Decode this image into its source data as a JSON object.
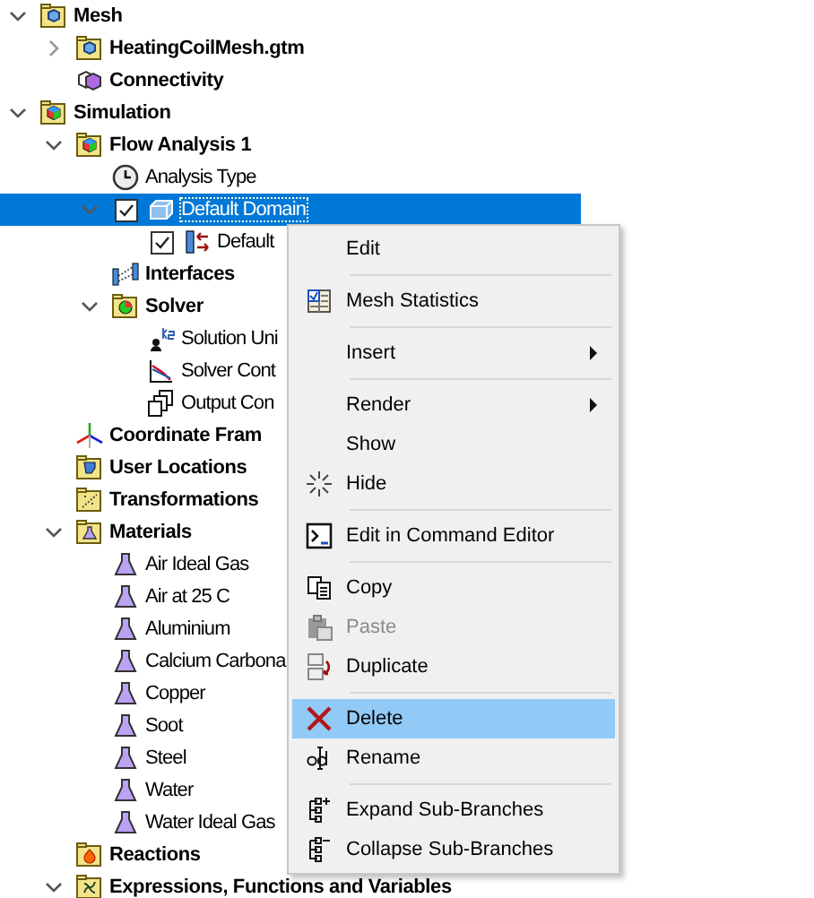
{
  "tree": [
    {
      "label": "Mesh",
      "kind": "folder-mesh",
      "bold": true,
      "expanded": true,
      "selected": false,
      "children": [
        {
          "label": "HeatingCoilMesh.gtm",
          "kind": "folder-mesh",
          "bold": true,
          "expanded": false,
          "selected": false
        },
        {
          "label": "Connectivity",
          "kind": "connectivity",
          "bold": true,
          "selected": false
        }
      ]
    },
    {
      "label": "Simulation",
      "kind": "folder-sim",
      "bold": true,
      "expanded": true,
      "selected": false,
      "children": [
        {
          "label": "Flow Analysis 1",
          "kind": "folder-sim",
          "bold": true,
          "expanded": true,
          "selected": false,
          "children": [
            {
              "label": "Analysis Type",
              "kind": "clock",
              "bold": false,
              "selected": false
            },
            {
              "label": "Default Domain",
              "kind": "box",
              "bold": false,
              "expanded": true,
              "checked": true,
              "selected": true,
              "children": [
                {
                  "label": "Default",
                  "kind": "boundary",
                  "bold": false,
                  "checked": true,
                  "selected": false
                }
              ]
            },
            {
              "label": "Interfaces",
              "kind": "interfaces",
              "bold": true,
              "selected": false
            },
            {
              "label": "Solver",
              "kind": "folder-solver",
              "bold": true,
              "expanded": true,
              "selected": false,
              "children": [
                {
                  "label": "Solution Uni",
                  "kind": "units",
                  "bold": false,
                  "selected": false
                },
                {
                  "label": "Solver Cont",
                  "kind": "solver-control",
                  "bold": false,
                  "selected": false
                },
                {
                  "label": "Output Con",
                  "kind": "output",
                  "bold": false,
                  "selected": false
                }
              ]
            }
          ]
        },
        {
          "label": "Coordinate Fram",
          "kind": "axes",
          "bold": true,
          "selected": false
        },
        {
          "label": "User Locations",
          "kind": "folder-locations",
          "bold": true,
          "selected": false
        },
        {
          "label": "Transformations",
          "kind": "folder-transform",
          "bold": true,
          "selected": false
        },
        {
          "label": "Materials",
          "kind": "folder-flask",
          "bold": true,
          "expanded": true,
          "selected": false,
          "children": [
            {
              "label": "Air Ideal Gas",
              "kind": "flask",
              "bold": false,
              "selected": false
            },
            {
              "label": "Air at 25 C",
              "kind": "flask",
              "bold": false,
              "selected": false
            },
            {
              "label": "Aluminium",
              "kind": "flask",
              "bold": false,
              "selected": false
            },
            {
              "label": "Calcium Carbona",
              "kind": "flask",
              "bold": false,
              "selected": false
            },
            {
              "label": "Copper",
              "kind": "flask",
              "bold": false,
              "selected": false
            },
            {
              "label": "Soot",
              "kind": "flask",
              "bold": false,
              "selected": false
            },
            {
              "label": "Steel",
              "kind": "flask",
              "bold": false,
              "selected": false
            },
            {
              "label": "Water",
              "kind": "flask",
              "bold": false,
              "selected": false
            },
            {
              "label": "Water Ideal Gas",
              "kind": "flask",
              "bold": false,
              "selected": false
            }
          ]
        },
        {
          "label": "Reactions",
          "kind": "folder-flame",
          "bold": true,
          "selected": false
        },
        {
          "label": "Expressions, Functions and Variables",
          "kind": "folder-expr",
          "bold": true,
          "expanded": true,
          "selected": false
        }
      ]
    }
  ],
  "context_menu": [
    {
      "kind": "plain",
      "label": "Edit",
      "disabled": false,
      "submenu": false,
      "selected": false
    },
    {
      "kind": "separator"
    },
    {
      "kind": "stats",
      "label": "Mesh Statistics",
      "disabled": false,
      "submenu": false,
      "selected": false
    },
    {
      "kind": "separator"
    },
    {
      "kind": "plain",
      "label": "Insert",
      "disabled": false,
      "submenu": true,
      "selected": false
    },
    {
      "kind": "separator"
    },
    {
      "kind": "plain",
      "label": "Render",
      "disabled": false,
      "submenu": true,
      "selected": false
    },
    {
      "kind": "plain",
      "label": "Show",
      "disabled": false,
      "submenu": false,
      "selected": false
    },
    {
      "kind": "hide",
      "label": "Hide",
      "disabled": false,
      "submenu": false,
      "selected": false
    },
    {
      "kind": "separator"
    },
    {
      "kind": "terminal",
      "label": "Edit in Command Editor",
      "disabled": false,
      "submenu": false,
      "selected": false
    },
    {
      "kind": "separator"
    },
    {
      "kind": "copy",
      "label": "Copy",
      "disabled": false,
      "submenu": false,
      "selected": false
    },
    {
      "kind": "paste",
      "label": "Paste",
      "disabled": true,
      "submenu": false,
      "selected": false
    },
    {
      "kind": "duplicate",
      "label": "Duplicate",
      "disabled": false,
      "submenu": false,
      "selected": false
    },
    {
      "kind": "separator"
    },
    {
      "kind": "delete",
      "label": "Delete",
      "disabled": false,
      "submenu": false,
      "selected": true
    },
    {
      "kind": "rename",
      "label": "Rename",
      "disabled": false,
      "submenu": false,
      "selected": false
    },
    {
      "kind": "separator"
    },
    {
      "kind": "expand",
      "label": "Expand Sub-Branches",
      "disabled": false,
      "submenu": false,
      "selected": false
    },
    {
      "kind": "collapse",
      "label": "Collapse Sub-Branches",
      "disabled": false,
      "submenu": false,
      "selected": false
    }
  ]
}
